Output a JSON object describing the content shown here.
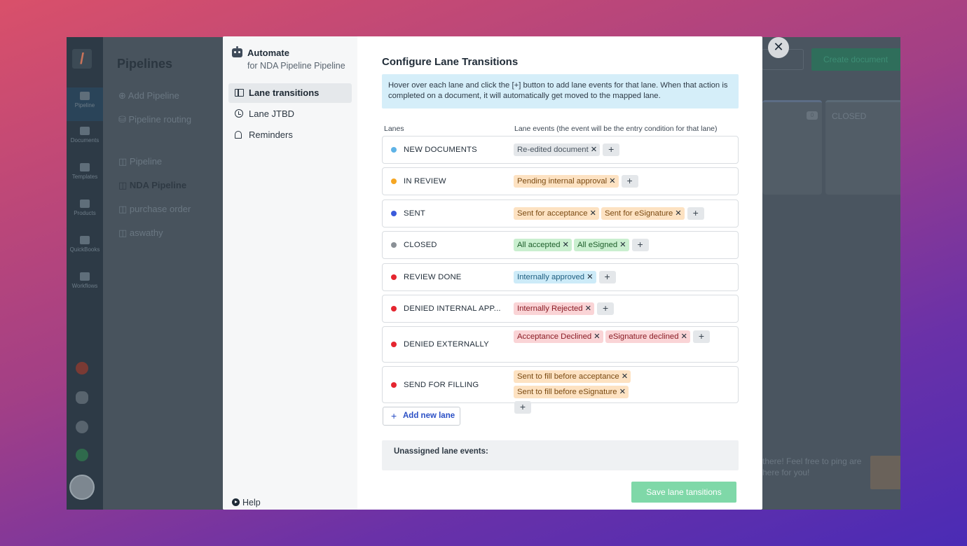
{
  "background_app": {
    "page_title": "Pipelines",
    "rail_items": [
      "Pipeline",
      "Documents",
      "Templates",
      "Products",
      "QuickBooks",
      "Workflows"
    ],
    "menu": {
      "add_pipeline": "Add Pipeline",
      "pipeline_routing": "Pipeline routing",
      "pipelines": [
        "Pipeline",
        "NDA Pipeline",
        "purchase order",
        "aswathy"
      ]
    },
    "create_button": "Create document",
    "lane_count": "0",
    "closed_lane": "CLOSED",
    "chat_text": "there! Feel free to ping are here for you!"
  },
  "modal": {
    "brand_title": "Automate",
    "brand_sub": "for NDA Pipeline Pipeline",
    "nav": [
      {
        "label": "Lane transitions",
        "icon": "columns-icon",
        "active": true
      },
      {
        "label": "Lane JTBD",
        "icon": "alarm-clock-icon",
        "active": false
      },
      {
        "label": "Reminders",
        "icon": "bell-icon",
        "active": false
      }
    ],
    "help_label": "Help",
    "title": "Configure Lane Transitions",
    "info": "Hover over each lane and click the [+] button to add lane events for that lane. When that action is completed on a document, it will automatically get moved to the mapped lane.",
    "col_lanes": "Lanes",
    "col_events": "Lane events (the event will be the entry condition for that lane)",
    "lanes": [
      {
        "name": "NEW DOCUMENTS",
        "color": "#5fb3e6",
        "events": [
          {
            "label": "Re-edited document",
            "style": "gray"
          }
        ]
      },
      {
        "name": "IN REVIEW",
        "color": "#f5a623",
        "events": [
          {
            "label": "Pending internal approval",
            "style": "orange"
          }
        ]
      },
      {
        "name": "SENT",
        "color": "#3b5bdb",
        "events": [
          {
            "label": "Sent for acceptance",
            "style": "orange"
          },
          {
            "label": "Sent for eSignature",
            "style": "orange"
          }
        ]
      },
      {
        "name": "CLOSED",
        "color": "#8a9096",
        "events": [
          {
            "label": "All accepted",
            "style": "green"
          },
          {
            "label": "All eSigned",
            "style": "green"
          }
        ]
      },
      {
        "name": "REVIEW DONE",
        "color": "#e5252f",
        "events": [
          {
            "label": "Internally approved",
            "style": "blue"
          }
        ]
      },
      {
        "name": "DENIED INTERNAL APP...",
        "color": "#e5252f",
        "events": [
          {
            "label": "Internally Rejected",
            "style": "red"
          }
        ]
      },
      {
        "name": "DENIED EXTERNALLY",
        "color": "#e5252f",
        "events": [
          {
            "label": "Acceptance Declined",
            "style": "red"
          },
          {
            "label": "eSignature declined",
            "style": "red"
          }
        ]
      },
      {
        "name": "SEND FOR FILLING",
        "color": "#e5252f",
        "events": [
          {
            "label": "Sent to fill before acceptance",
            "style": "orange"
          },
          {
            "label": "Sent to fill before eSignature",
            "style": "orange"
          }
        ]
      }
    ],
    "add_lane": "Add new lane",
    "unassigned": "Unassigned lane events:",
    "save_button": "Save lane tansitions",
    "close_glyph": "✕",
    "remove_glyph": "✕",
    "add_glyph": "+"
  }
}
